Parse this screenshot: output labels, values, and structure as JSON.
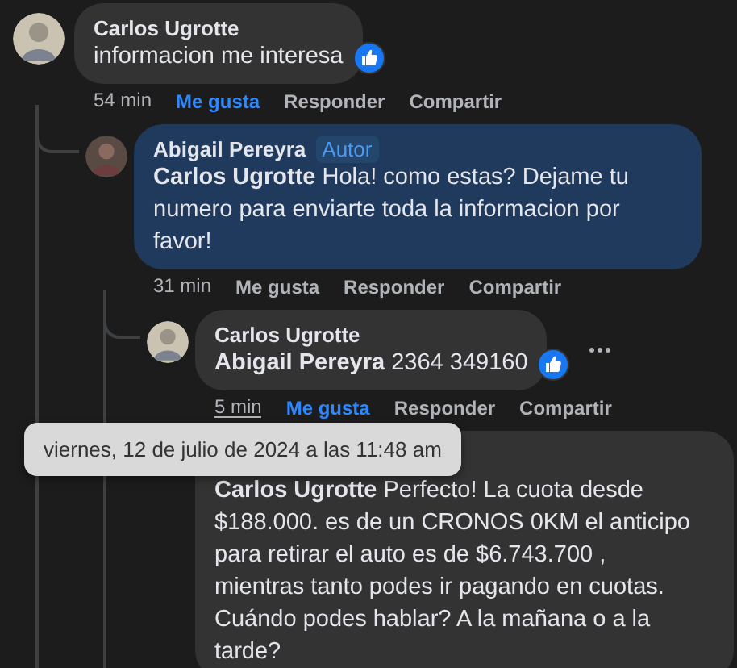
{
  "comments": [
    {
      "author": "Carlos Ugrotte",
      "text": "informacion me interesa",
      "reaction": true,
      "time": "54 min",
      "time_hovered": false,
      "liked": true,
      "more_menu": false,
      "highlight": false,
      "actions": [
        "Me gusta",
        "Responder",
        "Compartir"
      ],
      "replies": [
        {
          "author": "Abigail Pereyra",
          "badge": "Autor",
          "text": "**Carlos Ugrotte** Hola! como estas? Dejame tu numero para enviarte toda la informacion por favor!",
          "reaction": false,
          "time": "31 min",
          "time_hovered": false,
          "liked": false,
          "more_menu": false,
          "highlight": true,
          "actions": [
            "Me gusta",
            "Responder",
            "Compartir"
          ],
          "replies": [
            {
              "author": "Carlos Ugrotte",
              "text": "**Abigail Pereyra** 2364 349160",
              "reaction": true,
              "time": "5 min",
              "time_hovered": true,
              "liked": true,
              "more_menu": true,
              "highlight": false,
              "actions": [
                "Me gusta",
                "Responder",
                "Compartir"
              ]
            },
            {
              "text": "**Carlos Ugrotte** Perfecto! La cuota desde $188.000. es de un CRONOS 0KM el anticipo para retirar el auto es de $6.743.700 , mientras tanto podes ir pagando en cuotas. Cuándo podes hablar? A la mañana o a la tarde?",
              "reaction": false,
              "more_menu": false,
              "highlight": false
            }
          ]
        }
      ]
    }
  ],
  "tooltip": {
    "text": "viernes, 12 de julio de 2024 a las 11:48 am"
  }
}
